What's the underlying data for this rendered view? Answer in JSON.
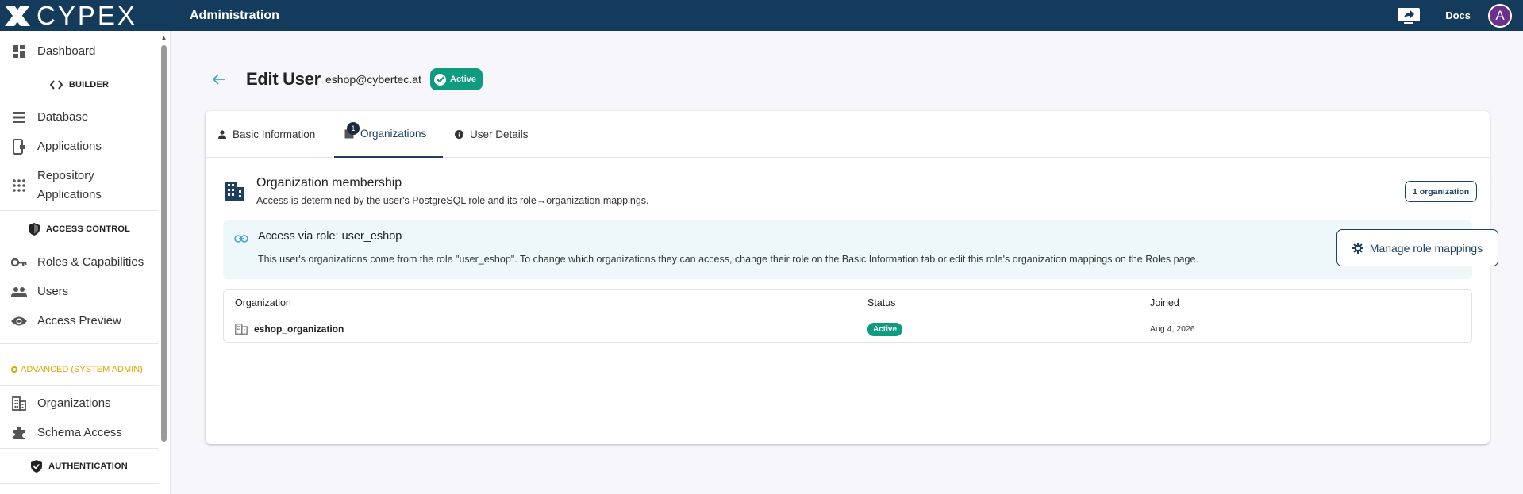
{
  "header": {
    "logo_text": "CYPEX",
    "title": "Administration",
    "docs_label": "Docs",
    "avatar_initial": "A"
  },
  "sidebar": {
    "items": [
      {
        "label": "Dashboard",
        "icon": "dashboard-icon"
      },
      {
        "label": "Database",
        "icon": "database-icon"
      },
      {
        "label": "Applications",
        "icon": "applications-icon"
      },
      {
        "label": "Repository Applications",
        "icon": "grid-icon"
      },
      {
        "label": "Roles & Capabilities",
        "icon": "key-icon"
      },
      {
        "label": "Users",
        "icon": "users-icon"
      },
      {
        "label": "Access Preview",
        "icon": "eye-icon"
      },
      {
        "label": "Organizations",
        "icon": "building-icon"
      },
      {
        "label": "Schema Access",
        "icon": "puzzle-icon"
      }
    ],
    "repository_line1": "Repository",
    "repository_line2": "Applications",
    "sections": {
      "builder": "BUILDER",
      "access_control": "ACCESS CONTROL",
      "advanced": "ADVANCED (SYSTEM ADMIN)",
      "authentication": "AUTHENTICATION"
    }
  },
  "page": {
    "title": "Edit User",
    "email": "eshop@cybertec.at",
    "status": "Active"
  },
  "tabs": [
    {
      "label": "Basic Information",
      "icon": "person-icon"
    },
    {
      "label": "Organizations",
      "icon": "building-icon",
      "badge": "1",
      "active": true
    },
    {
      "label": "User Details",
      "icon": "info-icon"
    }
  ],
  "membership": {
    "title": "Organization membership",
    "description": "Access is determined by the user's PostgreSQL role and its role→organization mappings.",
    "count_label": "1 organization"
  },
  "role_access": {
    "title": "Access via role: user_eshop",
    "description": "This user's organizations come from the role \"user_eshop\". To change which organizations they can access, change their role on the Basic Information tab or edit this role's organization mappings on the Roles page.",
    "button_label": "Manage role mappings"
  },
  "table": {
    "columns": [
      "Organization",
      "Status",
      "Joined"
    ],
    "rows": [
      {
        "organization": "eshop_organization",
        "status": "Active",
        "joined": "Aug 4, 2026"
      }
    ]
  },
  "colors": {
    "topbar": "#143a5c",
    "accent": "#1d3f60",
    "active_green": "#0e9c80",
    "advanced_yellow": "#e2a300",
    "avatar": "#6b2f8f"
  }
}
